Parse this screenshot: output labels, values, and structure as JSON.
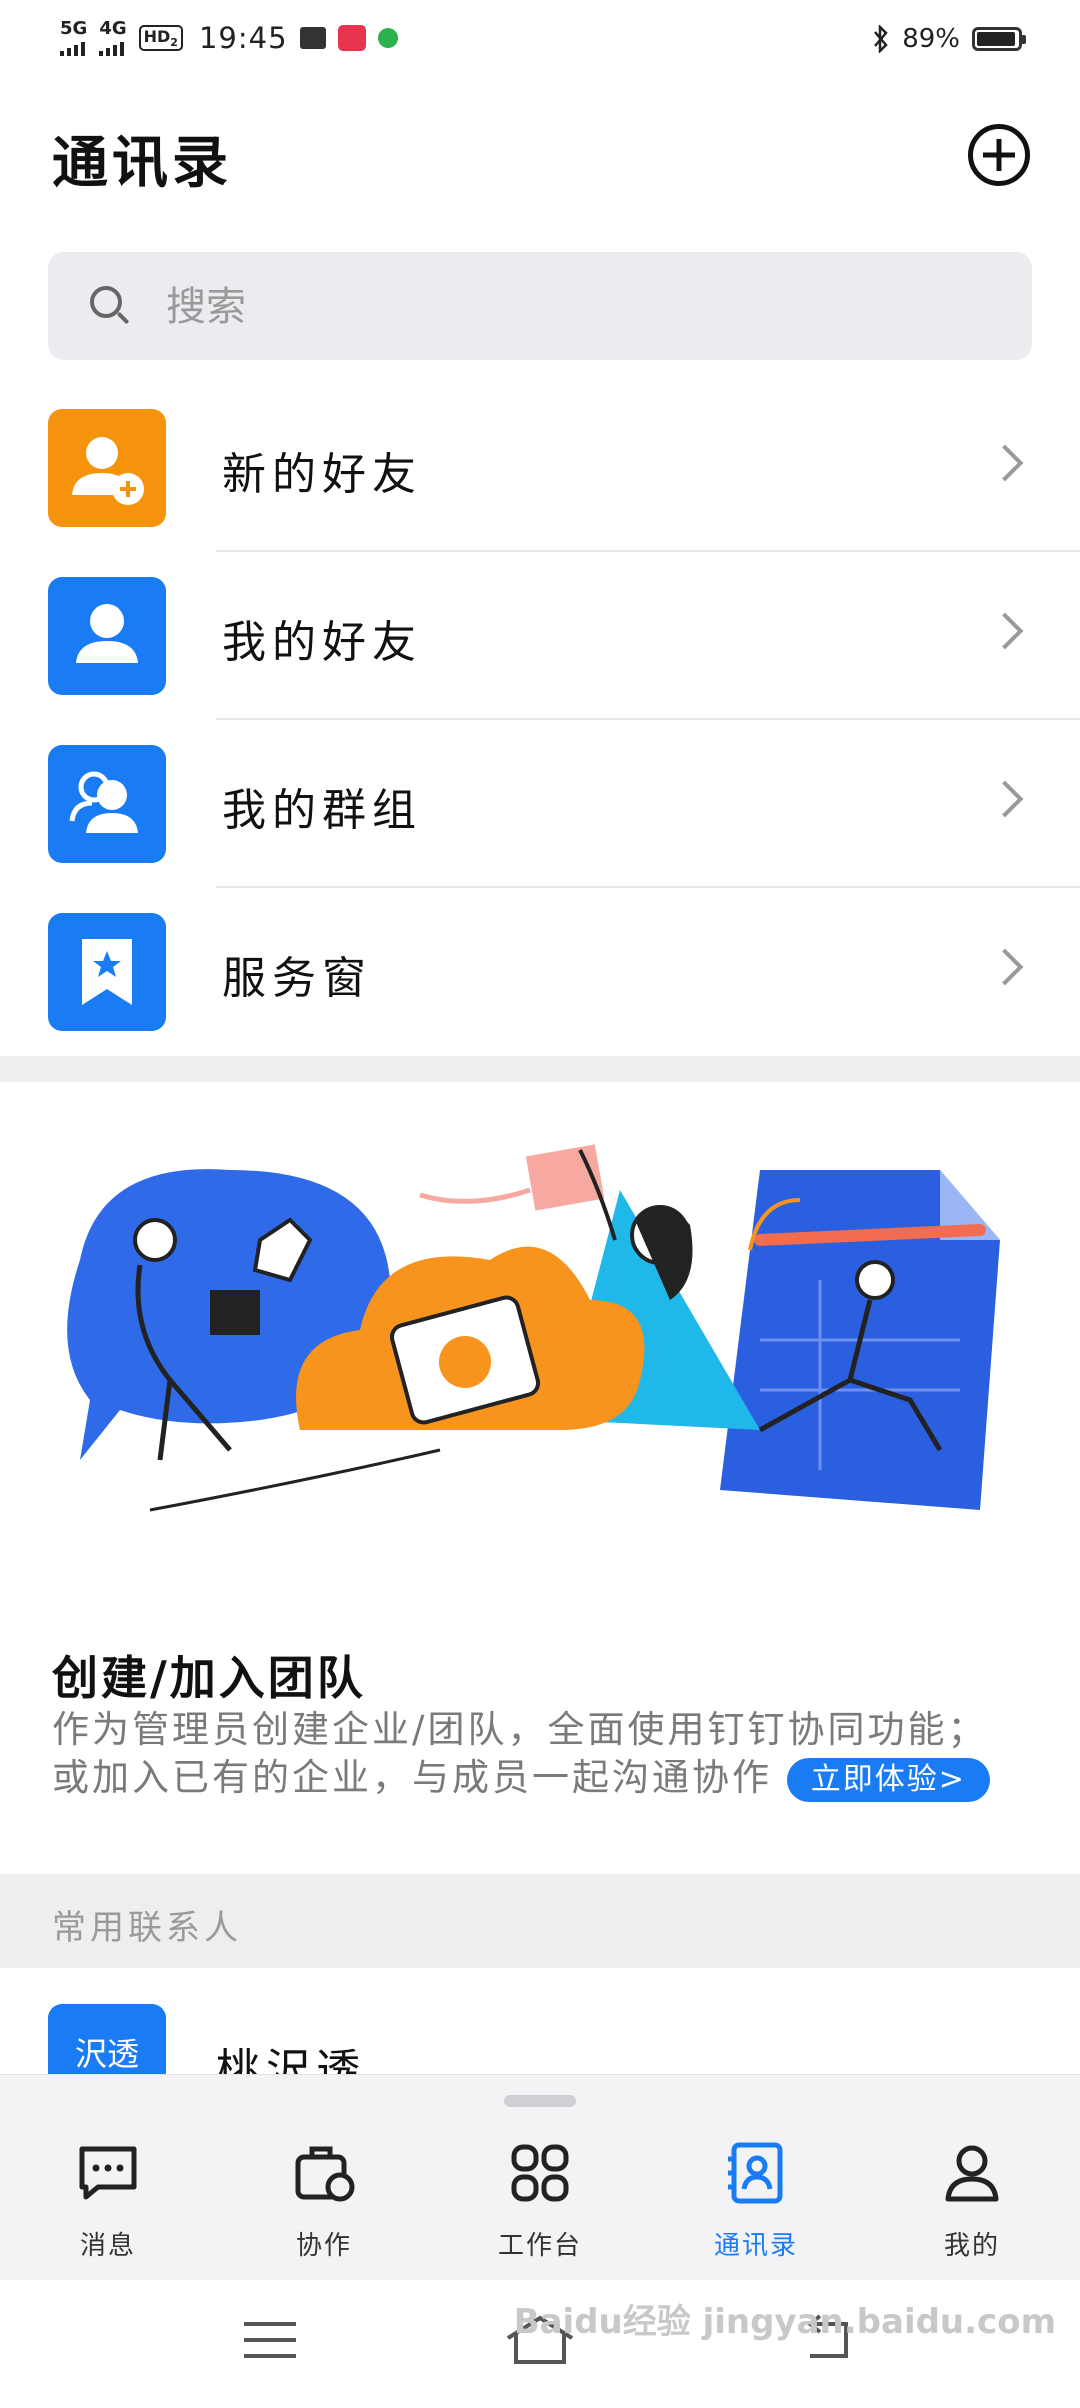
{
  "status_bar": {
    "net1": "5G",
    "net2": "4G",
    "hd": "HD",
    "hd_sub": "2",
    "time": "19:45",
    "battery": "89%"
  },
  "header": {
    "title": "通讯录"
  },
  "search": {
    "placeholder": "搜索"
  },
  "menu": [
    {
      "label": "新的好友",
      "icon": "add-friend-icon",
      "color": "#f6930c"
    },
    {
      "label": "我的好友",
      "icon": "person-icon",
      "color": "#1a7cf5"
    },
    {
      "label": "我的群组",
      "icon": "group-icon",
      "color": "#1a7cf5"
    },
    {
      "label": "服务窗",
      "icon": "bookmark-star-icon",
      "color": "#1a7cf5"
    }
  ],
  "team": {
    "title": "创建/加入团队",
    "desc1": "作为管理员创建企业/团队，全面使用钉钉协同功能；",
    "desc2": "或加入已有的企业，与成员一起沟通协作",
    "cta": "立即体验>"
  },
  "frequent": {
    "header": "常用联系人",
    "contacts": [
      {
        "avatar_text": "沢透",
        "name": "桃沢透"
      }
    ]
  },
  "tabs": [
    {
      "label": "消息",
      "icon": "message-icon"
    },
    {
      "label": "协作",
      "icon": "collaboration-icon"
    },
    {
      "label": "工作台",
      "icon": "workbench-icon"
    },
    {
      "label": "通讯录",
      "icon": "contacts-icon",
      "active": true
    },
    {
      "label": "我的",
      "icon": "profile-icon"
    }
  ],
  "colors": {
    "accent": "#1a7cf5",
    "orange": "#f6930c"
  },
  "watermark": "Baidu经验 jingyan.baidu.com"
}
